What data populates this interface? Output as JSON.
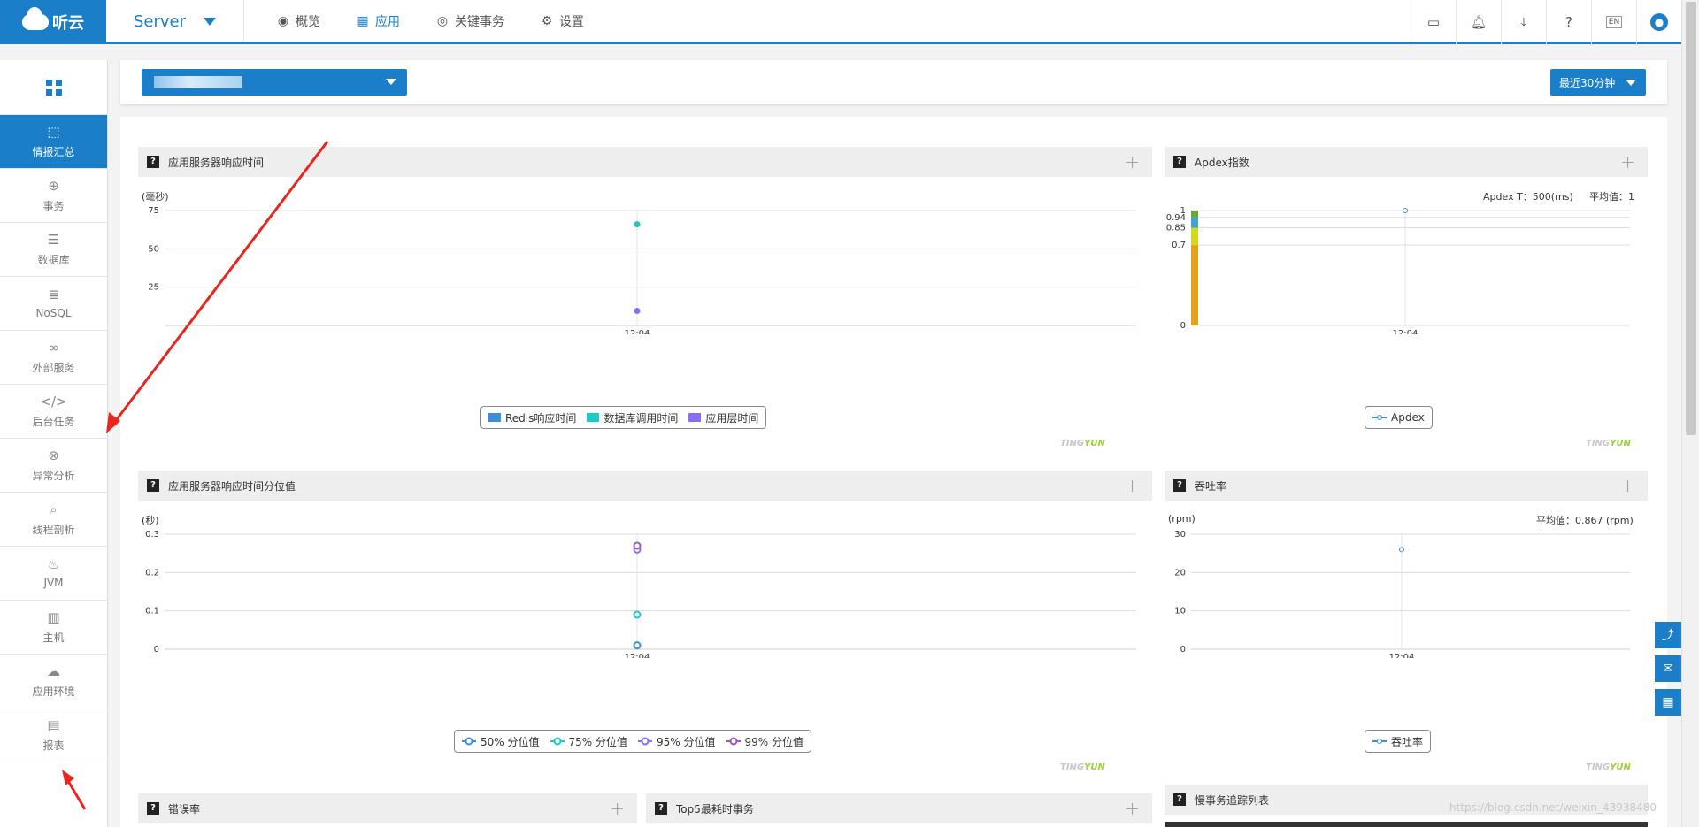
{
  "header": {
    "logo_text": "听云",
    "product": "Server",
    "nav": [
      {
        "label": "概览",
        "icon": "eye-icon"
      },
      {
        "label": "应用",
        "icon": "grid-icon"
      },
      {
        "label": "关键事务",
        "icon": "target-icon"
      },
      {
        "label": "设置",
        "icon": "gear-icon"
      }
    ],
    "lang": "EN"
  },
  "sidebar": {
    "items": [
      {
        "label": "情报汇总",
        "icon": "dashboard-icon"
      },
      {
        "label": "事务",
        "icon": "globe-icon"
      },
      {
        "label": "数据库",
        "icon": "database-icon"
      },
      {
        "label": "NoSQL",
        "icon": "list-icon"
      },
      {
        "label": "外部服务",
        "icon": "link-icon"
      },
      {
        "label": "后台任务",
        "icon": "code-icon"
      },
      {
        "label": "异常分析",
        "icon": "error-icon"
      },
      {
        "label": "线程剖析",
        "icon": "search-icon"
      },
      {
        "label": "JVM",
        "icon": "java-icon"
      },
      {
        "label": "主机",
        "icon": "server-icon"
      },
      {
        "label": "应用环境",
        "icon": "environment-icon"
      },
      {
        "label": "报表",
        "icon": "report-icon"
      }
    ]
  },
  "filter": {
    "time_range": "最近30分钟"
  },
  "panels": {
    "response_time": {
      "title": "应用服务器响应时间",
      "unit": "(毫秒)"
    },
    "apdex": {
      "title": "Apdex指数",
      "apdex_t": "Apdex T：500(ms)",
      "avg": "平均值：1"
    },
    "percentile": {
      "title": "应用服务器响应时间分位值",
      "unit": "(秒)"
    },
    "throughput": {
      "title": "吞吐率",
      "unit": "(rpm)",
      "avg": "平均值：0.867 (rpm)"
    },
    "error_rate": {
      "title": "错误率"
    },
    "top5": {
      "title": "Top5最耗时事务"
    },
    "slow_trace": {
      "title": "慢事务追踪列表"
    }
  },
  "watermark": {
    "a": "TING",
    "b": "YUN"
  },
  "csdn_watermark": "https://blog.csdn.net/weixin_43938480",
  "chart_data": [
    {
      "type": "scatter",
      "title": "应用服务器响应时间",
      "ylabel": "(毫秒)",
      "categories": [
        "12:04"
      ],
      "y_ticks": [
        75,
        50,
        25
      ],
      "ylim": [
        0,
        75
      ],
      "series": [
        {
          "name": "Redis响应时间",
          "color": "#3b8fd9",
          "values": [
            null
          ]
        },
        {
          "name": "数据库调用时间",
          "color": "#1ec8c8",
          "values": [
            66
          ]
        },
        {
          "name": "应用层时间",
          "color": "#8a6df0",
          "values": [
            9.5
          ]
        }
      ]
    },
    {
      "type": "bar",
      "title": "Apdex指数",
      "categories": [
        "12:04"
      ],
      "y_ticks": [
        1,
        0.94,
        0.85,
        0.7,
        0
      ],
      "ylim": [
        0,
        1
      ],
      "bands": [
        {
          "from": 0,
          "to": 0.7,
          "color": "#e8a020"
        },
        {
          "from": 0.7,
          "to": 0.85,
          "color": "#d4d91f"
        },
        {
          "from": 0.85,
          "to": 0.94,
          "color": "#3fa3d8"
        },
        {
          "from": 0.94,
          "to": 1,
          "color": "#6aa53a"
        }
      ],
      "series": [
        {
          "name": "Apdex",
          "color": "#3b8fd9",
          "values": [
            1
          ]
        }
      ]
    },
    {
      "type": "scatter",
      "title": "应用服务器响应时间分位值",
      "ylabel": "(秒)",
      "categories": [
        "12:04"
      ],
      "y_ticks": [
        0.3,
        0.2,
        0.1,
        0
      ],
      "ylim": [
        0,
        0.3
      ],
      "series": [
        {
          "name": "50% 分位值",
          "color": "#3b8fd9",
          "values": [
            0.01
          ]
        },
        {
          "name": "75% 分位值",
          "color": "#1ec8c8",
          "values": [
            0.09
          ]
        },
        {
          "name": "95% 分位值",
          "color": "#8a6df0",
          "values": [
            0.26
          ]
        },
        {
          "name": "99% 分位值",
          "color": "#9b59b6",
          "values": [
            0.27
          ]
        }
      ]
    },
    {
      "type": "line",
      "title": "吞吐率",
      "ylabel": "(rpm)",
      "categories": [
        "12:04"
      ],
      "y_ticks": [
        30,
        20,
        10,
        0
      ],
      "ylim": [
        0,
        30
      ],
      "series": [
        {
          "name": "吞吐率",
          "color": "#3b8fd9",
          "values": [
            26
          ]
        }
      ]
    }
  ]
}
